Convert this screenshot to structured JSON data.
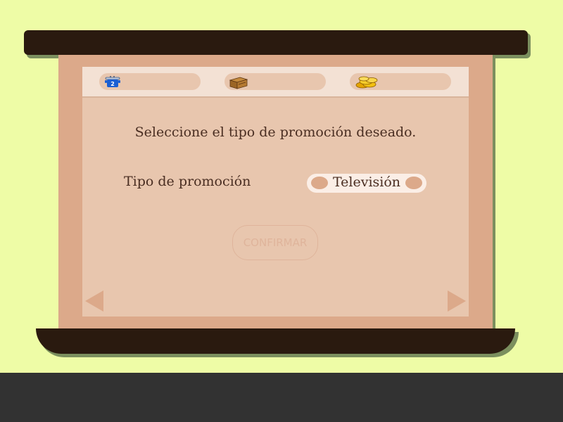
{
  "status_bar": {
    "items": [
      {
        "icon": "pot-icon",
        "badge": "2",
        "value": ""
      },
      {
        "icon": "crate-icon",
        "value": ""
      },
      {
        "icon": "coins-icon",
        "value": ""
      }
    ]
  },
  "dialog": {
    "instruction": "Seleccione el tipo de promoción deseado.",
    "promo_label": "Tipo de promoción",
    "promo_selected": "Televisión",
    "confirm_label": "CONFIRMAR"
  },
  "colors": {
    "background": "#eefca6",
    "frame_dark": "#2a1a0f",
    "board": "#dca98a",
    "screen": "#e8c6ae",
    "text": "#4a2e22"
  }
}
